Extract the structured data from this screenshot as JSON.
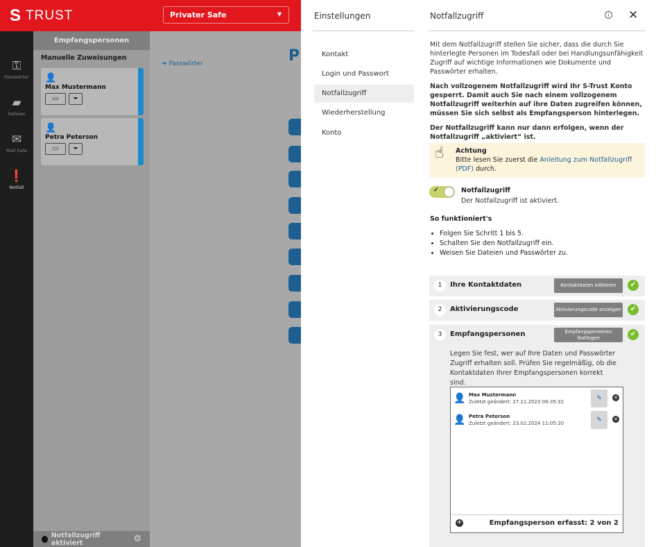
{
  "app": {
    "logo_text": "TRUST",
    "logo_s": "S",
    "safe_selector": "Privater Safe"
  },
  "leftnav": [
    {
      "label": "Passwörter",
      "icon": "key-icon"
    },
    {
      "label": "Dateien",
      "icon": "folder-icon"
    },
    {
      "label": "Mail Safe",
      "icon": "mail-icon"
    },
    {
      "label": "Notfall",
      "icon": "alert-icon"
    }
  ],
  "recipients_panel": {
    "header": "Empfangspersonen",
    "subheader": "Manuelle Zuweisungen",
    "cards": [
      {
        "name": "Max Mustermann"
      },
      {
        "name": "Petra Peterson"
      }
    ],
    "status": "Notfallzugriff aktiviert"
  },
  "main": {
    "breadcrumb": "Passwörter",
    "title_initial": "P"
  },
  "drawer": {
    "settings_title": "Einstellungen",
    "section_title": "Notfallzugriff",
    "menu": [
      "Kontakt",
      "Login und Passwort",
      "Notfallzugriff",
      "Wiederherstellung",
      "Konto"
    ],
    "intro": "Mit dem Notfallzugriff stellen Sie sicher, dass die durch Sie hinterlegte Personen im Todesfall oder bei Handlungsunfähigkeit Zugriff auf wichtige Informationen wie Dokumente und Passwörter erhalten.",
    "bold1": "Nach vollzogenem Notfallzugriff wird Ihr S-Trust Konto gesperrt. Damit auch Sie nach einem vollzogenem Notfallzugriff weiterhin auf ihre Daten zugreifen können, müssen Sie sich selbst als Empfangsperson hinterlegen.",
    "bold2": "Der Notfallzugriff kann nur dann erfolgen, wenn der Notfallzugriff „aktiviert“ ist.",
    "warning": {
      "title": "Achtung",
      "pre": "Bitte lesen Sie zuerst die ",
      "link": "Anleitung zum Notfallzugriff (PDF)",
      "post": " durch."
    },
    "toggle": {
      "title": "Notfallzugriff",
      "subtitle": "Der Notfallzugriff ist aktiviert.",
      "on": true
    },
    "how_title": "So funktioniert's",
    "how_items": [
      "Folgen Sie Schritt 1 bis 5.",
      "Schalten Sie den Notfallzugriff ein.",
      "Weisen Sie Dateien und Passwörter zu."
    ],
    "steps": [
      {
        "num": "1",
        "label": "Ihre Kontaktdaten",
        "button": "Kontaktdaten editieren"
      },
      {
        "num": "2",
        "label": "Aktivierungscode",
        "button": "Aktivierungscode anzeigen"
      },
      {
        "num": "3",
        "label": "Empfangspersonen",
        "button": "Empfangspersonen festlegen"
      }
    ],
    "step3_text": "Legen Sie fest, wer auf Ihre Daten und Passwörter Zugriff erhalten soll. Prüfen Sie regelmäßig, ob die Kontaktdaten Ihrer Empfangspersonen korrekt sind.",
    "recipients": [
      {
        "name": "Max Mustermann",
        "changed": "Zuletzt geändert: 27.11.2023 09:35:32"
      },
      {
        "name": "Petra Peterson",
        "changed": "Zuletzt geändert: 23.02.2024 11:05:20"
      }
    ],
    "recipient_count": "Empfangsperson erfasst: 2 von 2"
  },
  "colors": {
    "brand": "#e2171d",
    "accent": "#1c5f90",
    "ok": "#7bbd2b"
  }
}
